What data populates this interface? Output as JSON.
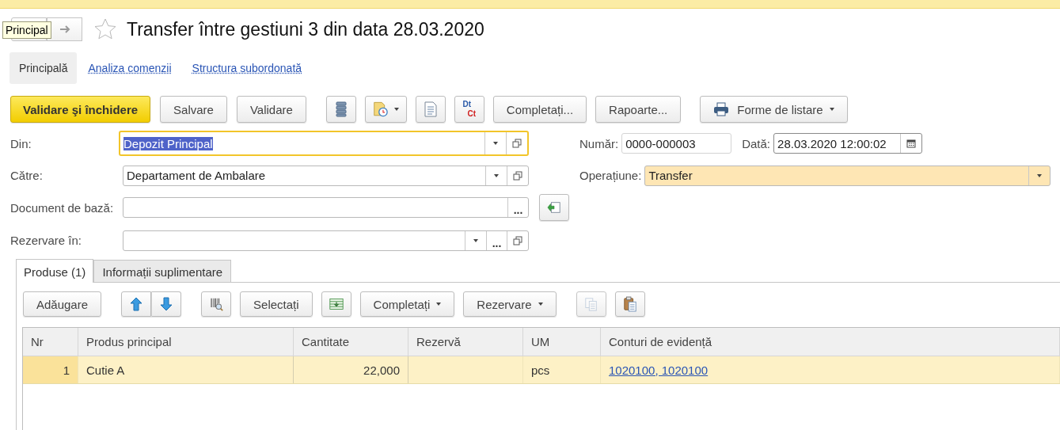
{
  "header": {
    "tooltip": "Principal",
    "title": "Transfer între gestiuni 3 din data 28.03.2020",
    "favorite": false
  },
  "tabs": [
    {
      "label": "Principală",
      "selected": true
    },
    {
      "label": "Analiza comenzii",
      "selected": false
    },
    {
      "label": "Structura subordonată",
      "selected": false
    }
  ],
  "toolbar": [
    {
      "kind": "primary",
      "label": "Validare şi închidere"
    },
    {
      "kind": "text",
      "label": "Salvare"
    },
    {
      "kind": "text",
      "label": "Validare"
    },
    {
      "kind": "icon",
      "dropdown": false
    },
    {
      "kind": "icon",
      "dropdown": true
    },
    {
      "kind": "icon",
      "dropdown": false
    },
    {
      "kind": "dtct",
      "lines": [
        "Dt",
        "Ct"
      ]
    },
    {
      "kind": "text",
      "label": "Completați..."
    },
    {
      "kind": "text",
      "label": "Rapoarte..."
    },
    {
      "kind": "print",
      "label": "Forme de listare",
      "dropdown": true
    }
  ],
  "form": {
    "left": [
      {
        "label": "Din:",
        "value": "Depozit Principal",
        "focused": true,
        "controls": [
          {
            "kind": "dropdown"
          },
          {
            "kind": "open"
          }
        ]
      },
      {
        "label": "Către:",
        "value": "Departament de Ambalare",
        "focused": false,
        "controls": [
          {
            "kind": "dropdown"
          },
          {
            "kind": "open"
          }
        ]
      },
      {
        "label": "Document de bază:",
        "focused": false,
        "controls": [
          {
            "kind": "choice",
            "label": "..."
          }
        ],
        "side_button": true
      },
      {
        "label": "Rezervare în:",
        "focused": false,
        "controls": [
          {
            "kind": "dropdown"
          },
          {
            "kind": "choice",
            "label": "..."
          },
          {
            "kind": "open"
          }
        ]
      }
    ],
    "right": [
      {
        "items": [
          {
            "label": "Număr:",
            "value": "0000-000003",
            "kind": "plain"
          },
          {
            "label": "Dată:",
            "value": "28.03.2020 12:00:02",
            "kind": "date"
          }
        ]
      },
      {
        "items": [
          {
            "label": "Operațiune:",
            "value": "Transfer",
            "kind": "select",
            "highlighted": true
          }
        ]
      }
    ]
  },
  "subtabs": [
    {
      "label": "Produse (1)",
      "selected": true
    },
    {
      "label": "Informații suplimentare",
      "selected": false
    }
  ],
  "table_toolbar": [
    {
      "kind": "text",
      "label": "Adăugare"
    },
    {
      "kind": "updown"
    },
    {
      "kind": "icon",
      "disabled": false
    },
    {
      "kind": "text",
      "label": "Selectați"
    },
    {
      "kind": "icon",
      "disabled": false
    },
    {
      "kind": "text",
      "label": "Completați",
      "dropdown": true
    },
    {
      "kind": "text",
      "label": "Rezervare",
      "dropdown": true
    },
    {
      "kind": "icon",
      "disabled": true
    },
    {
      "kind": "icon",
      "disabled": false
    }
  ],
  "table": {
    "columns": [
      "Nr",
      "Produs principal",
      "Cantitate",
      "Rezervă",
      "UM",
      "Conturi de evidență"
    ],
    "rows": [
      {
        "selected": true,
        "cells": [
          "1",
          "Cutie A",
          "22,000",
          "",
          "pcs",
          "1020100, 1020100"
        ]
      }
    ]
  }
}
